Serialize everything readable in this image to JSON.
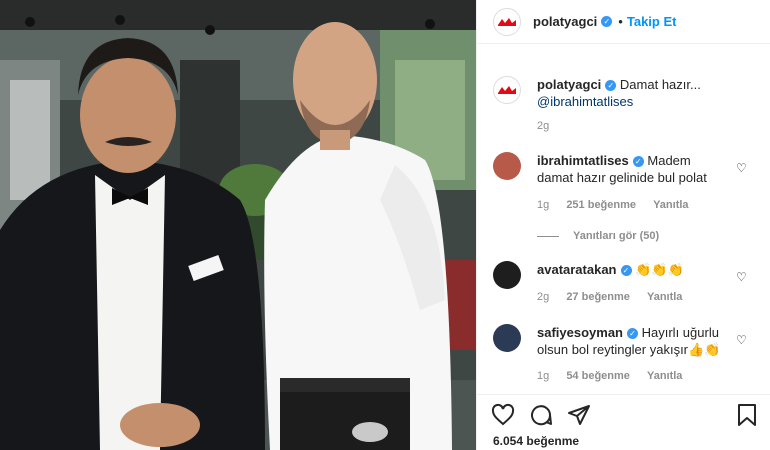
{
  "post": {
    "author": "polatyagci",
    "follow_label": "Takip Et",
    "separator": "•",
    "caption": {
      "user": "polatyagci",
      "text": "Damat hazır...",
      "mention": "@ibrahimtatlises",
      "age": "2g"
    }
  },
  "comments": [
    {
      "user": "ibrahimtatlises",
      "text": "Madem damat hazır gelinide bul polat",
      "age": "1g",
      "likes": "251 beğenme",
      "reply": "Yanıtla",
      "view_replies": "Yanıtları gör (50)"
    },
    {
      "user": "avataratakan",
      "text": "👏👏👏",
      "age": "2g",
      "likes": "27 beğenme",
      "reply": "Yanıtla"
    },
    {
      "user": "safiyesoyman",
      "text": "Hayırlı uğurlu olsun bol reytingler yakışır👍👏",
      "age": "1g",
      "likes": "54 beğenme",
      "reply": "Yanıtla"
    }
  ],
  "likes_total": "6.054 beğenme",
  "icons": {
    "like": "heart-icon",
    "comment": "comment-icon",
    "share": "share-icon",
    "save": "bookmark-icon",
    "verified": "verified-badge-icon"
  },
  "colors": {
    "link": "#00376b",
    "follow": "#0095f6",
    "verified": "#3897f0",
    "muted": "#8e8e8e"
  }
}
